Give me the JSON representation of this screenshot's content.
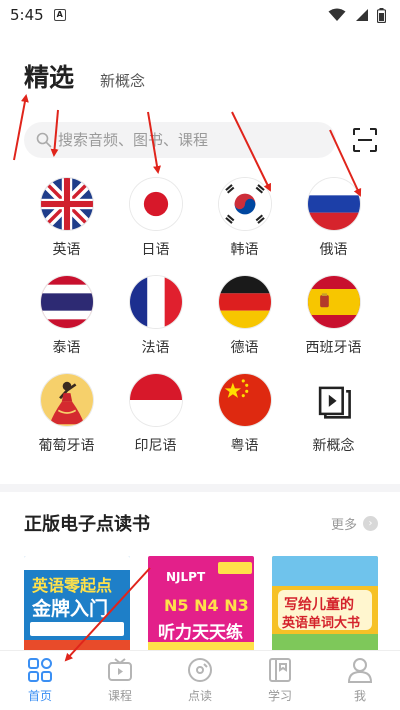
{
  "status": {
    "time": "5:45",
    "notif_glyph": "A"
  },
  "tabs": [
    {
      "label": "精选"
    },
    {
      "label": "新概念"
    }
  ],
  "search": {
    "placeholder": "搜索音频、图书、课程"
  },
  "languages": [
    {
      "label": "英语",
      "flag": "uk-flag"
    },
    {
      "label": "日语",
      "flag": "japan-flag"
    },
    {
      "label": "韩语",
      "flag": "korea-flag"
    },
    {
      "label": "俄语",
      "flag": "russia-flag"
    },
    {
      "label": "泰语",
      "flag": "thailand-flag"
    },
    {
      "label": "法语",
      "flag": "france-flag"
    },
    {
      "label": "德语",
      "flag": "germany-flag"
    },
    {
      "label": "西班牙语",
      "flag": "spain-flag"
    },
    {
      "label": "葡萄牙语",
      "flag": "portuguese-dancer-icon"
    },
    {
      "label": "印尼语",
      "flag": "indonesia-flag"
    },
    {
      "label": "粤语",
      "flag": "china-flag"
    },
    {
      "label": "新概念",
      "flag": "video-book-icon"
    }
  ],
  "ebooks": {
    "title": "正版电子点读书",
    "more": "更多",
    "books": [
      {
        "line1": "英语零起点",
        "line2": "金牌入门"
      },
      {
        "brand": "NJLPT",
        "line1": "N5 N4 N3",
        "line2": "听力天天练"
      },
      {
        "line1": "写给儿童的",
        "line2": "英语单词大书"
      }
    ]
  },
  "nav": [
    {
      "label": "首页",
      "active": true
    },
    {
      "label": "课程",
      "active": false
    },
    {
      "label": "点读",
      "active": false
    },
    {
      "label": "学习",
      "active": false
    },
    {
      "label": "我",
      "active": false
    }
  ],
  "colors": {
    "accent": "#3b8ff3",
    "annotation": "#e0241b",
    "search_bg": "#f3f3f4"
  }
}
